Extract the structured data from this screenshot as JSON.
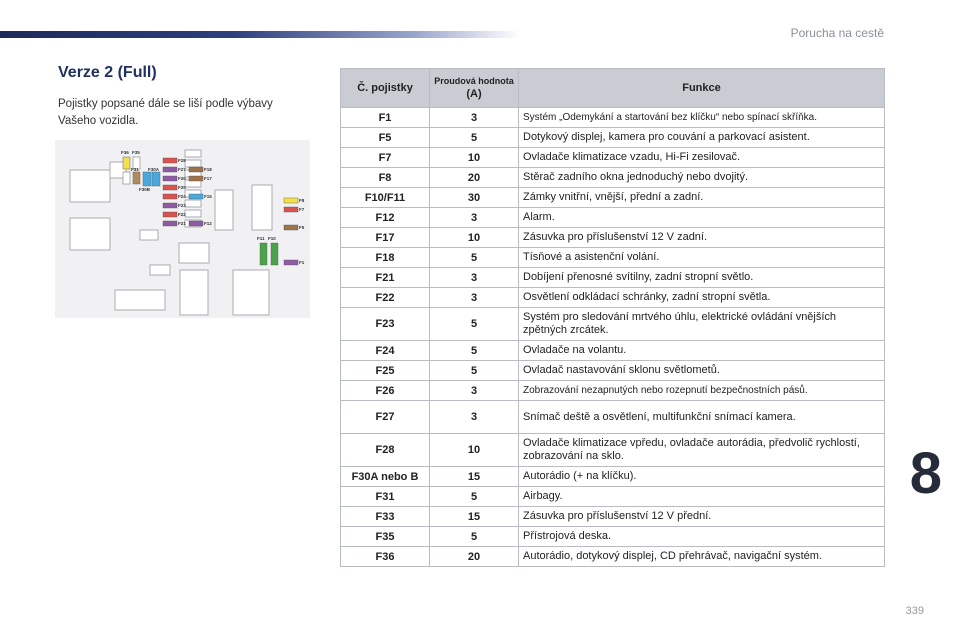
{
  "chapter_title": "Porucha na cestě",
  "section_title": "Verze 2 (Full)",
  "intro_text": "Pojistky popsané dále se liší podle výbavy Vašeho vozidla.",
  "table": {
    "header": {
      "col1": "Č. pojistky",
      "col2_top": "Proudová hodnota",
      "col2_bottom": "(A)",
      "col3": "Funkce"
    },
    "rows": [
      {
        "no": "F1",
        "amp": "3",
        "func": "Systém „Odemykání a startování bez klíčku“ nebo spínací skříňka."
      },
      {
        "no": "F5",
        "amp": "5",
        "func": "Dotykový displej, kamera pro couvání a parkovací asistent."
      },
      {
        "no": "F7",
        "amp": "10",
        "func": "Ovladače klimatizace vzadu, Hi-Fi zesilovač."
      },
      {
        "no": "F8",
        "amp": "20",
        "func": "Stěrač zadního okna jednoduchý nebo dvojitý."
      },
      {
        "no": "F10/F11",
        "amp": "30",
        "func": "Zámky vnitřní, vnější, přední a zadní."
      },
      {
        "no": "F12",
        "amp": "3",
        "func": "Alarm."
      },
      {
        "no": "F17",
        "amp": "10",
        "func": "Zásuvka pro příslušenství 12 V zadní."
      },
      {
        "no": "F18",
        "amp": "5",
        "func": "Tísňové a asistenční volání."
      },
      {
        "no": "F21",
        "amp": "3",
        "func": "Dobíjení přenosné svítilny, zadní stropní světlo."
      },
      {
        "no": "F22",
        "amp": "3",
        "func": "Osvětlení odkládací schránky, zadní stropní světla."
      },
      {
        "no": "F23",
        "amp": "5",
        "func": "Systém pro sledování mrtvého úhlu, elektrické ovládání vnějších zpětných zrcátek."
      },
      {
        "no": "F24",
        "amp": "5",
        "func": "Ovladače na volantu."
      },
      {
        "no": "F25",
        "amp": "5",
        "func": "Ovladač nastavování sklonu světlometů."
      },
      {
        "no": "F26",
        "amp": "3",
        "func": "Zobrazování nezapnutých nebo rozepnutí bezpečnostních pásů."
      },
      {
        "no": "F27",
        "amp": "3",
        "func": "Snímač deště a osvětlení, multifunkční snímací kamera."
      },
      {
        "no": "F28",
        "amp": "10",
        "func": "Ovladače klimatizace vpředu, ovladače autorádia, předvolič rychlostí, zobrazování na sklo."
      },
      {
        "no": "F30A nebo B",
        "amp": "15",
        "func": "Autorádio (+ na klíčku)."
      },
      {
        "no": "F31",
        "amp": "5",
        "func": "Airbagy."
      },
      {
        "no": "F33",
        "amp": "15",
        "func": "Zásuvka pro příslušenství 12 V přední."
      },
      {
        "no": "F35",
        "amp": "5",
        "func": "Přístrojová deska."
      },
      {
        "no": "F36",
        "amp": "20",
        "func": "Autorádio, dotykový displej, CD přehrávač, navigační systém."
      }
    ]
  },
  "diagram_labels": {
    "f36": "F36",
    "f35": "F35",
    "f31": "F31",
    "f30a": "F30A",
    "f30b": "F30B",
    "f28": "F28",
    "f27": "F27",
    "f26": "F26",
    "f25": "F25",
    "f24": "F24",
    "f23": "F23",
    "f22": "F22",
    "f21": "F21",
    "f18": "F18",
    "f17": "F17",
    "f15": "F15",
    "f12": "F12",
    "f11": "F11",
    "f10": "F10",
    "f8": "F8",
    "f7": "F7",
    "f5": "F5",
    "f1": "F1"
  },
  "chapter_number": "8",
  "page_number": "339"
}
